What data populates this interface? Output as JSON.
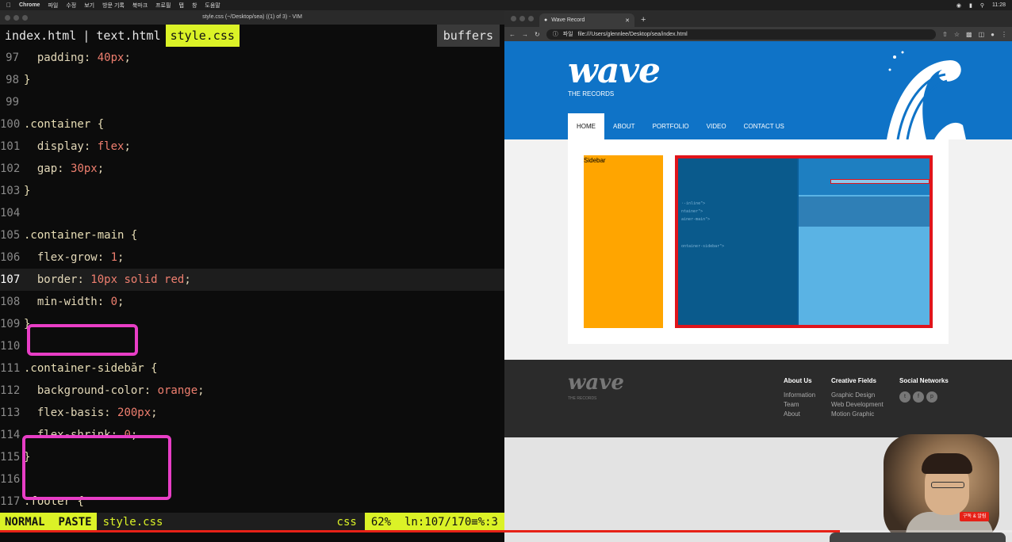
{
  "menubar": {
    "app": "Chrome",
    "items": [
      "파일",
      "수정",
      "보기",
      "방문 기록",
      "북마크",
      "프로필",
      "탭",
      "창",
      "도움말"
    ],
    "clock": "11:28"
  },
  "vim": {
    "window_title": "style.css (~/Desktop/sea) ((1) of 3) - VIM",
    "tabs": [
      "index.html",
      "text.html",
      "style.css"
    ],
    "active_tab": "style.css",
    "buffers_label": "buffers",
    "lines": [
      {
        "n": "97",
        "indent": "  ",
        "prop": "padding",
        "val": "40px"
      },
      {
        "n": "98",
        "text": "}"
      },
      {
        "n": "99",
        "text": ""
      },
      {
        "n": "100",
        "text": ".container {"
      },
      {
        "n": "101",
        "indent": "  ",
        "prop": "display",
        "val": "flex"
      },
      {
        "n": "102",
        "indent": "  ",
        "prop": "gap",
        "val": "30px"
      },
      {
        "n": "103",
        "text": "}"
      },
      {
        "n": "104",
        "text": ""
      },
      {
        "n": "105",
        "text": ".container-main {"
      },
      {
        "n": "106",
        "indent": "  ",
        "prop": "flex-grow",
        "val": "1"
      },
      {
        "n": "107",
        "indent": "  ",
        "prop": "border",
        "val": "10px solid red"
      },
      {
        "n": "108",
        "indent": "  ",
        "prop": "min-width",
        "val": "0"
      },
      {
        "n": "109",
        "text": "}"
      },
      {
        "n": "110",
        "text": ""
      },
      {
        "n": "111",
        "text": ".container-sidebăr {"
      },
      {
        "n": "112",
        "indent": "  ",
        "prop": "background-color",
        "val": "orange"
      },
      {
        "n": "113",
        "indent": "  ",
        "prop": "flex-basis",
        "val": "200px"
      },
      {
        "n": "114",
        "indent": "  ",
        "prop": "flex-shrink",
        "val": "0"
      },
      {
        "n": "115",
        "text": "}"
      },
      {
        "n": "116",
        "text": ""
      },
      {
        "n": "117",
        "text": ".footer {"
      }
    ],
    "status": {
      "mode": "NORMAL",
      "paste": "PASTE",
      "file": "style.css",
      "filetype": "css",
      "percent": "62%",
      "position": "ln:107/170≡%:3"
    }
  },
  "browser": {
    "tab_title": "Wave Record",
    "address_prefix": "파일",
    "url": "file:///Users/glennlee/Desktop/sea/index.html"
  },
  "site": {
    "logo": "wave",
    "logo_sub": "THE RECORDS",
    "nav": [
      "HOME",
      "ABOUT",
      "PORTFOLIO",
      "VIDEO",
      "CONTACT US"
    ],
    "sidebar_label": "Sidebar",
    "footer": {
      "logo": "wave",
      "logo_sub": "THE RECORDS",
      "col1": {
        "heading": "About Us",
        "items": [
          "Information",
          "Team",
          "About"
        ]
      },
      "col2": {
        "heading": "Creative Fields",
        "items": [
          "Graphic Design",
          "Web Development",
          "Motion Graphic"
        ]
      },
      "col3": {
        "heading": "Social Networks"
      }
    }
  },
  "video": {
    "progress": 0.83,
    "subscribe_badge": "구독 & 알림"
  },
  "colors": {
    "vim_accent": "#dbf227",
    "highlight_box": "#e83ec6",
    "site_blue": "#0f73c7",
    "sidebar_orange": "#ffa500",
    "main_border_red": "#e0141b"
  }
}
